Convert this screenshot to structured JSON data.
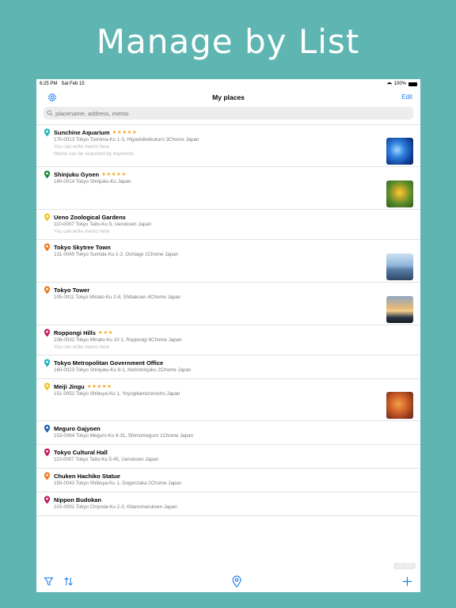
{
  "headline": "Manage by List",
  "status": {
    "time": "6:25 PM",
    "date": "Sat Feb 15",
    "battery": "100%"
  },
  "nav": {
    "title": "My places",
    "edit_label": "Edit"
  },
  "search": {
    "placeholder": "placename, address, memo"
  },
  "places": [
    {
      "name": "Sunchine Aquarium",
      "stars": "★★★★★",
      "address": "170-0013 Tokyo Toshima-Ku 1-3, Higashiikebukuro 3Chome Japan",
      "memo": [
        "You can write memo here.",
        "Memo can be searched by keywords."
      ],
      "pin_color": "#1fb6c1",
      "thumb": "aquarium"
    },
    {
      "name": "Shinjuku Gyoen",
      "stars": "★★★★★",
      "address": "160-0014 Tokyo Shinjuku-Ku Japan",
      "memo": [],
      "pin_color": "#168a3a",
      "thumb": "flower"
    },
    {
      "name": "Ueno Zoological Gardens",
      "stars": "",
      "address": "110-0007 Tokyo Taito-Ku 9, Uenokoen Japan",
      "memo": [
        "You can write memo here."
      ],
      "pin_color": "#f3c623",
      "thumb": ""
    },
    {
      "name": "Tokyo Skytree Town",
      "stars": "",
      "address": "131-0045 Tokyo Sumida-Ku 1-2, Oshiage 1Chome Japan",
      "memo": [],
      "pin_color": "#f07a1a",
      "thumb": "sky"
    },
    {
      "name": "Tokyo Tower",
      "stars": "",
      "address": "105-0011 Tokyo Minato-Ku 2-8, Shibakoen 4Chome Japan",
      "memo": [],
      "pin_color": "#f07a1a",
      "thumb": "sunset"
    },
    {
      "name": "Roppongi Hills",
      "stars": "★★★",
      "address": "106-0032 Tokyo Minato-Ku 10-1, Roppongi 6Chome Japan",
      "memo": [
        "You can write memo here."
      ],
      "pin_color": "#c2185b",
      "thumb": ""
    },
    {
      "name": "Tokyo Metropolitan Government Office",
      "stars": "",
      "address": "160-0023 Tokyo Shinjuku-Ku 8-1, Nishishinjuku 2Chome Japan",
      "memo": [],
      "pin_color": "#1fb6c1",
      "thumb": ""
    },
    {
      "name": "Meiji Jingu",
      "stars": "★★★★★",
      "address": "151-0052 Tokyo Shibuya-Ku 1, Yoyogikamizonocho Japan",
      "memo": [],
      "pin_color": "#f3c623",
      "thumb": "autumn"
    },
    {
      "name": "Meguro Gajyoen",
      "stars": "",
      "address": "153-0064 Tokyo Meguro-Ku 8-31, Shimomeguro 1Chome Japan",
      "memo": [],
      "pin_color": "#1a5fb4",
      "thumb": ""
    },
    {
      "name": "Tokyo Cultural Hall",
      "stars": "",
      "address": "110-0007 Tokyo Taito-Ku 5-45, Uenokoen Japan",
      "memo": [],
      "pin_color": "#c2185b",
      "thumb": ""
    },
    {
      "name": "Chuken Hachiko Statue",
      "stars": "",
      "address": "150-0043 Tokyo Shibuya-Ku 1, Dogenzaka 2Chome Japan",
      "memo": [],
      "pin_color": "#f07a1a",
      "thumb": ""
    },
    {
      "name": "Nippon Budokan",
      "stars": "",
      "address": "102-0091 Tokyo Chiyoda-Ku 2-3, Kitanomarukoen Japan",
      "memo": [],
      "pin_color": "#c2185b",
      "thumb": ""
    }
  ],
  "counter": "12 / 15",
  "toolbar": {
    "icons": [
      "filter-icon",
      "sort-icon",
      "map-pin-icon",
      "add-icon"
    ]
  },
  "colors": {
    "background": "#5fb5b2",
    "accent": "#1a7cf0",
    "star": "#f5a623"
  }
}
